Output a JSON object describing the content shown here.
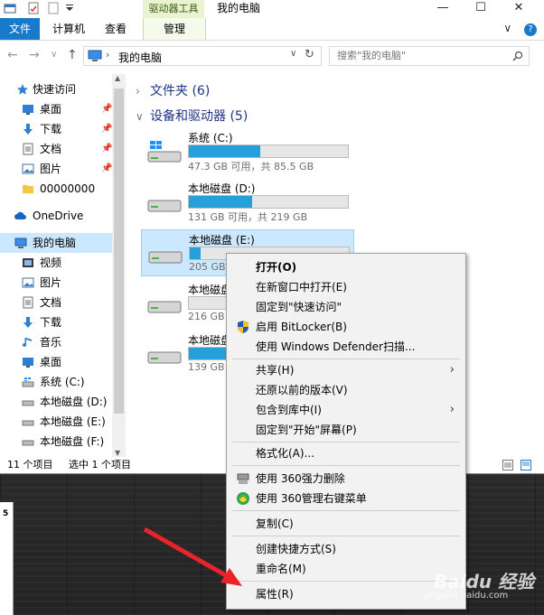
{
  "titlebar": {
    "tools_tab": "驱动器工具",
    "title": "我的电脑",
    "minimize": "—",
    "maximize": "☐",
    "close": "✕"
  },
  "ribbon": {
    "tabs": [
      "文件",
      "计算机",
      "查看",
      "管理"
    ],
    "expand_icon": "∨",
    "help_icon": "?"
  },
  "address": {
    "path": "我的电脑",
    "search_placeholder": "搜索\"我的电脑\""
  },
  "navpane": {
    "items": [
      {
        "label": "快速访问",
        "icon": "star-icon",
        "pinned": false
      },
      {
        "label": "桌面",
        "icon": "desktop-icon",
        "pinned": true
      },
      {
        "label": "下载",
        "icon": "download-icon",
        "pinned": true
      },
      {
        "label": "文档",
        "icon": "document-icon",
        "pinned": true
      },
      {
        "label": "图片",
        "icon": "picture-icon",
        "pinned": true
      },
      {
        "label": "00000000",
        "icon": "folder-icon",
        "pinned": false
      },
      {
        "label": "OneDrive",
        "icon": "cloud-icon",
        "pinned": false
      },
      {
        "label": "我的电脑",
        "icon": "computer-icon",
        "pinned": false
      },
      {
        "label": "视频",
        "icon": "video-icon",
        "pinned": false
      },
      {
        "label": "图片",
        "icon": "picture-icon",
        "pinned": false
      },
      {
        "label": "文档",
        "icon": "document-icon",
        "pinned": false
      },
      {
        "label": "下载",
        "icon": "download-icon",
        "pinned": false
      },
      {
        "label": "音乐",
        "icon": "music-icon",
        "pinned": false
      },
      {
        "label": "桌面",
        "icon": "desktop-icon",
        "pinned": false
      },
      {
        "label": "系统 (C:)",
        "icon": "drive-icon",
        "pinned": false
      },
      {
        "label": "本地磁盘 (D:)",
        "icon": "drive-icon",
        "pinned": false
      },
      {
        "label": "本地磁盘 (E:)",
        "icon": "drive-icon",
        "pinned": false
      },
      {
        "label": "本地磁盘 (F:)",
        "icon": "drive-icon",
        "pinned": false
      }
    ],
    "selected": "我的电脑"
  },
  "content": {
    "folders_header": "文件夹 (6)",
    "devices_header": "设备和驱动器 (5)",
    "drives": [
      {
        "name": "系统 (C:)",
        "info": "47.3 GB 可用，共 85.5 GB",
        "used_fraction": 0.45
      },
      {
        "name": "本地磁盘 (D:)",
        "info": "131 GB 可用，共 219 GB",
        "used_fraction": 0.4
      },
      {
        "name": "本地磁盘 (E:)",
        "info": "205 GB",
        "used_fraction": 0.07
      },
      {
        "name": "本地磁盘",
        "info": "216 GB",
        "used_fraction": 0.0
      },
      {
        "name": "本地磁盘",
        "info": "139 GB",
        "used_fraction": 0.3
      }
    ]
  },
  "status": {
    "count": "11 个项目",
    "selected": "选中 1 个项目"
  },
  "context_menu": {
    "items": [
      {
        "label": "打开(O)",
        "bold": true
      },
      {
        "label": "在新窗口中打开(E)"
      },
      {
        "label": "固定到\"快速访问\""
      },
      {
        "label": "启用 BitLocker(B)",
        "icon": "shield-icon"
      },
      {
        "label": "使用 Windows Defender扫描..."
      },
      {
        "label": "共享(H)",
        "submenu": true
      },
      {
        "label": "还原以前的版本(V)"
      },
      {
        "label": "包含到库中(I)",
        "submenu": true
      },
      {
        "label": "固定到\"开始\"屏幕(P)"
      },
      {
        "label": "格式化(A)..."
      },
      {
        "label": "使用 360强力删除",
        "icon": "shredder-icon"
      },
      {
        "label": "使用 360管理右键菜单",
        "icon": "360-icon"
      },
      {
        "label": "复制(C)"
      },
      {
        "label": "创建快捷方式(S)"
      },
      {
        "label": "重命名(M)"
      },
      {
        "label": "属性(R)"
      }
    ]
  },
  "watermark": {
    "main": "Baidu 经验",
    "sub": "jingyan.baidu.com"
  },
  "paper": {
    "text": "5"
  },
  "colors": {
    "accent": "#1979ca",
    "drive_fill": "#26a0da",
    "selection": "#cce8ff",
    "arrow": "#e8242a"
  }
}
